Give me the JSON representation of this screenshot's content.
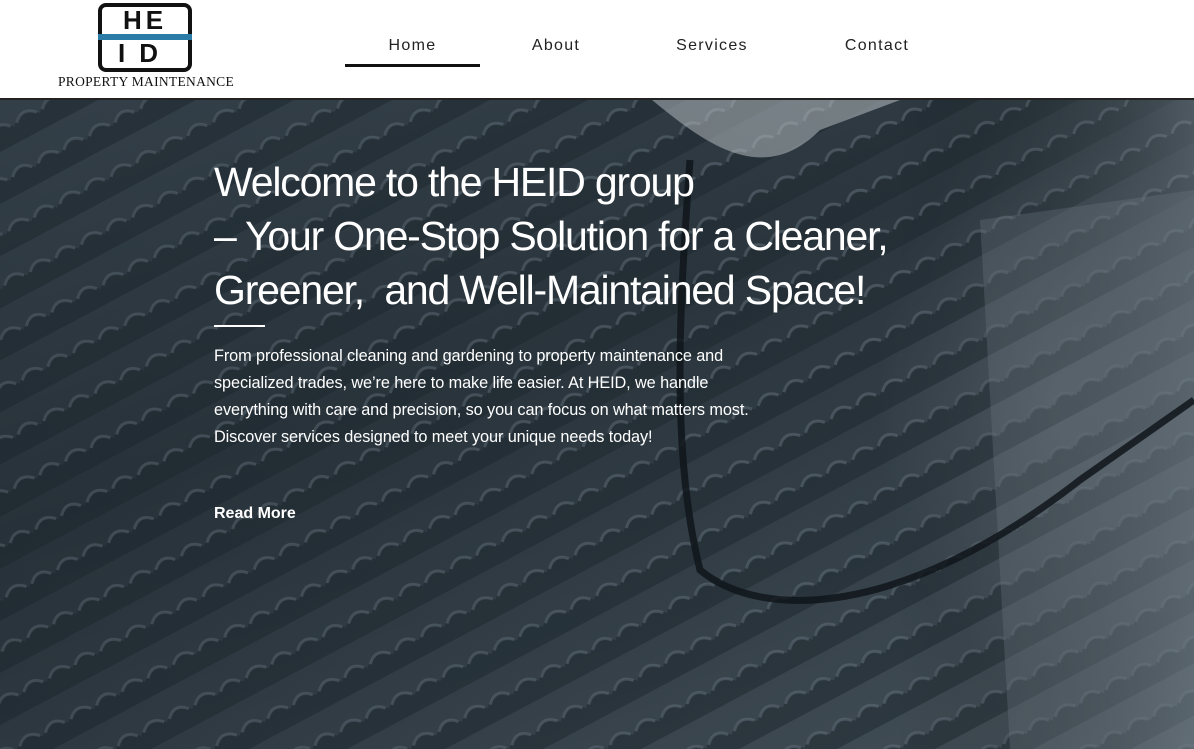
{
  "header": {
    "logo": {
      "top_text": "HE",
      "bottom_text": "ID",
      "tagline": "PROPERTY MAINTENANCE"
    },
    "nav": [
      {
        "label": "Home",
        "active": true
      },
      {
        "label": "About",
        "active": false
      },
      {
        "label": "Services",
        "active": false
      },
      {
        "label": "Contact",
        "active": false
      }
    ]
  },
  "hero": {
    "title": "Welcome to the HEID group\n– Your One-Stop Solution for a Cleaner, Greener,  and Well-Maintained Space!",
    "description": "From professional cleaning and gardening to property maintenance and specialized trades, we’re here to make life easier. At HEID, we handle everything with care and precision, so you can focus on what matters most. Discover services designed to meet your unique needs today!",
    "read_more": "Read More"
  },
  "colors": {
    "logo_accent": "#2a7ba6",
    "text_dark": "#222222",
    "hero_text": "#ffffff"
  }
}
